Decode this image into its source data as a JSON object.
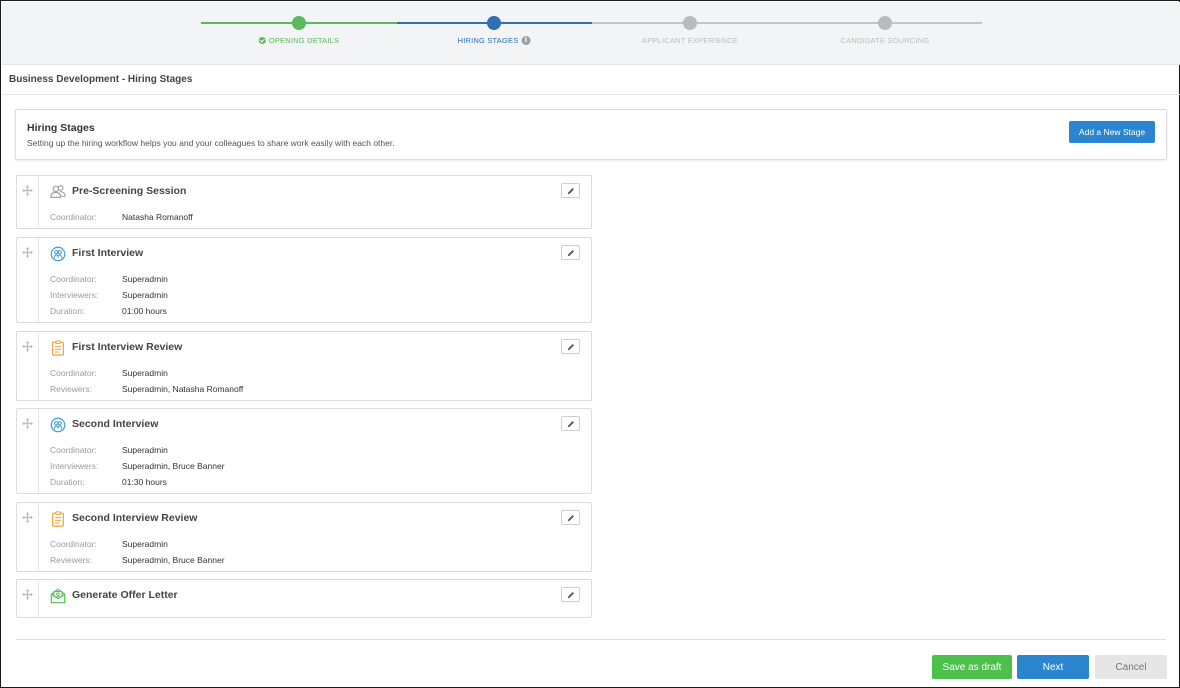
{
  "stepper": {
    "steps": [
      {
        "label": "OPENING DETAILS",
        "state": "done",
        "color": "#5cb85c"
      },
      {
        "label": "HIRING STAGES",
        "state": "active",
        "color": "#2f6fb5"
      },
      {
        "label": "APPLICANT EXPERIENCE",
        "state": "pending",
        "color": "#bbbbbb"
      },
      {
        "label": "CANDIDATE SOURCING",
        "state": "pending",
        "color": "#bbbbbb"
      }
    ],
    "info_icon": "i"
  },
  "page": {
    "title": "Business Development - Hiring Stages"
  },
  "header": {
    "title": "Hiring Stages",
    "subtitle": "Setting up the hiring workflow helps you and your colleagues to share work easily with each other.",
    "add_button": "Add a New Stage"
  },
  "stages": [
    {
      "name": "Pre-Screening Session",
      "icon": "group-outline-icon",
      "fields": [
        {
          "label": "Coordinator:",
          "value": "Natasha Romanoff"
        }
      ]
    },
    {
      "name": "First Interview",
      "icon": "interview-icon",
      "fields": [
        {
          "label": "Coordinator:",
          "value": "Superadmin"
        },
        {
          "label": "Interviewers:",
          "value": "Superadmin"
        },
        {
          "label": "Duration:",
          "value": "01:00 hours"
        }
      ]
    },
    {
      "name": "First Interview Review",
      "icon": "clipboard-icon",
      "fields": [
        {
          "label": "Coordinator:",
          "value": "Superadmin"
        },
        {
          "label": "Reviewers:",
          "value": "Superadmin, Natasha Romanoff"
        }
      ]
    },
    {
      "name": "Second Interview",
      "icon": "interview-icon",
      "fields": [
        {
          "label": "Coordinator:",
          "value": "Superadmin"
        },
        {
          "label": "Interviewers:",
          "value": "Superadmin, Bruce Banner"
        },
        {
          "label": "Duration:",
          "value": "01:30 hours"
        }
      ]
    },
    {
      "name": "Second Interview Review",
      "icon": "clipboard-icon",
      "fields": [
        {
          "label": "Coordinator:",
          "value": "Superadmin"
        },
        {
          "label": "Reviewers:",
          "value": "Superadmin, Bruce Banner"
        }
      ]
    },
    {
      "name": "Generate Offer Letter",
      "icon": "offer-letter-icon",
      "fields": []
    }
  ],
  "footer": {
    "save_draft": "Save as draft",
    "next": "Next",
    "cancel": "Cancel"
  },
  "colors": {
    "primary": "#2b86cf",
    "success": "#4cc04a",
    "blue_icon": "#3a9ad9",
    "orange_icon": "#f0a030",
    "green_icon": "#4cc04a",
    "gray_icon": "#9a9a9a"
  }
}
